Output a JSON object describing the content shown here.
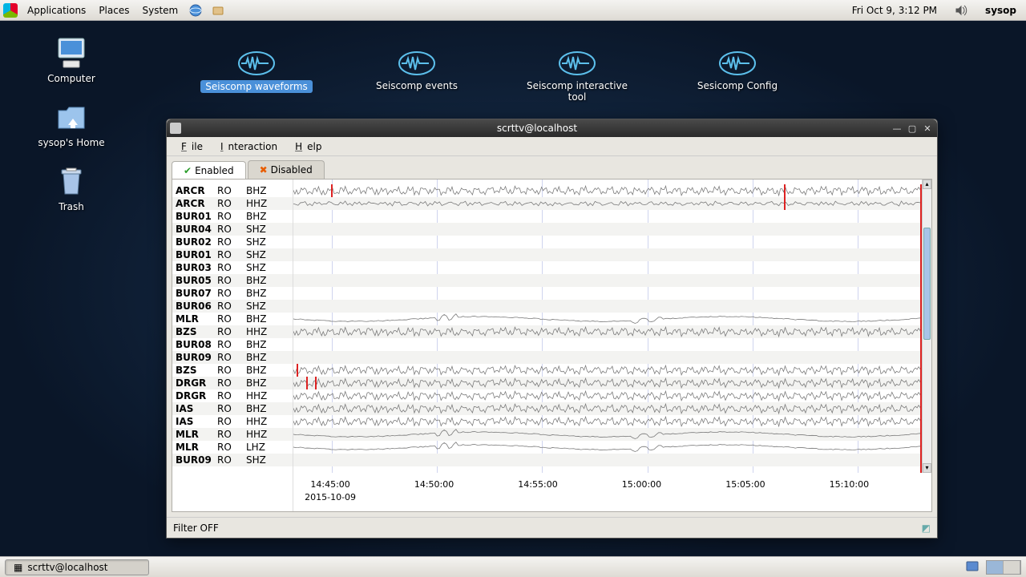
{
  "topbar": {
    "menus": [
      "Applications",
      "Places",
      "System"
    ],
    "clock": "Fri Oct  9,   3:12 PM",
    "user": "sysop"
  },
  "desktop_icons": {
    "computer": "Computer",
    "home": "sysop's Home",
    "trash": "Trash"
  },
  "launchers": {
    "waveforms": "Seiscomp waveforms",
    "events": "Seiscomp events",
    "interactive": "Seiscomp interactive tool",
    "config": "Sesicomp Config"
  },
  "window": {
    "title": "scrttv@localhost",
    "menus": {
      "file": "File",
      "interaction": "Interaction",
      "help": "Help"
    },
    "tabs": {
      "enabled": "Enabled",
      "disabled": "Disabled"
    },
    "status": "Filter OFF"
  },
  "channels": [
    {
      "sta": "ARCR",
      "net": "RO",
      "ch": "BHZ",
      "wave": 1,
      "mark": [
        6,
        78
      ]
    },
    {
      "sta": "ARCR",
      "net": "RO",
      "ch": "HHZ",
      "wave": 2,
      "mark": [
        78
      ]
    },
    {
      "sta": "BUR01",
      "net": "RO",
      "ch": "BHZ",
      "wave": 0
    },
    {
      "sta": "BUR04",
      "net": "RO",
      "ch": "SHZ",
      "wave": 0
    },
    {
      "sta": "BUR02",
      "net": "RO",
      "ch": "SHZ",
      "wave": 0
    },
    {
      "sta": "BUR01",
      "net": "RO",
      "ch": "SHZ",
      "wave": 0
    },
    {
      "sta": "BUR03",
      "net": "RO",
      "ch": "SHZ",
      "wave": 0
    },
    {
      "sta": "BUR05",
      "net": "RO",
      "ch": "BHZ",
      "wave": 0
    },
    {
      "sta": "BUR07",
      "net": "RO",
      "ch": "BHZ",
      "wave": 0
    },
    {
      "sta": "BUR06",
      "net": "RO",
      "ch": "SHZ",
      "wave": 0
    },
    {
      "sta": "MLR",
      "net": "RO",
      "ch": "BHZ",
      "wave": 3
    },
    {
      "sta": "BZS",
      "net": "RO",
      "ch": "HHZ",
      "wave": 1
    },
    {
      "sta": "BUR08",
      "net": "RO",
      "ch": "BHZ",
      "wave": 0
    },
    {
      "sta": "BUR09",
      "net": "RO",
      "ch": "BHZ",
      "wave": 0
    },
    {
      "sta": "BZS",
      "net": "RO",
      "ch": "BHZ",
      "wave": 1,
      "mark": [
        0.5
      ]
    },
    {
      "sta": "DRGR",
      "net": "RO",
      "ch": "BHZ",
      "wave": 1,
      "mark": [
        2,
        3.5
      ]
    },
    {
      "sta": "DRGR",
      "net": "RO",
      "ch": "HHZ",
      "wave": 1
    },
    {
      "sta": "IAS",
      "net": "RO",
      "ch": "BHZ",
      "wave": 1
    },
    {
      "sta": "IAS",
      "net": "RO",
      "ch": "HHZ",
      "wave": 1
    },
    {
      "sta": "MLR",
      "net": "RO",
      "ch": "HHZ",
      "wave": 3
    },
    {
      "sta": "MLR",
      "net": "RO",
      "ch": "LHZ",
      "wave": 3
    },
    {
      "sta": "BUR09",
      "net": "RO",
      "ch": "SHZ",
      "wave": 0
    }
  ],
  "time_ticks": [
    "14:45:00",
    "14:50:00",
    "14:55:00",
    "15:00:00",
    "15:05:00",
    "15:10:00"
  ],
  "time_date": "2015-10-09",
  "taskbar": {
    "task": "scrttv@localhost"
  }
}
